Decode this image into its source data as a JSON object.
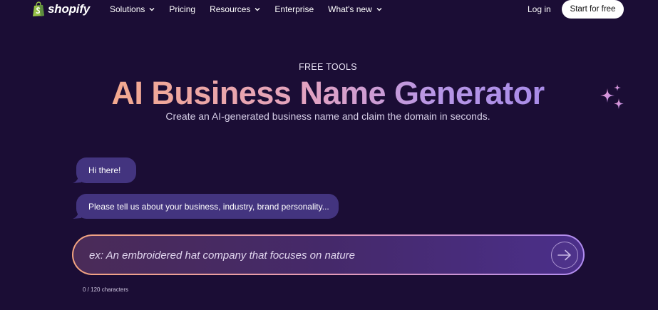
{
  "nav": {
    "logo_text": "shopify",
    "items": [
      {
        "label": "Solutions",
        "has_dropdown": true
      },
      {
        "label": "Pricing",
        "has_dropdown": false
      },
      {
        "label": "Resources",
        "has_dropdown": true
      },
      {
        "label": "Enterprise",
        "has_dropdown": false
      },
      {
        "label": "What's new",
        "has_dropdown": true
      }
    ],
    "login_label": "Log in",
    "cta_label": "Start for free"
  },
  "hero": {
    "eyebrow": "FREE TOOLS",
    "title": "AI Business Name Generator",
    "subtitle": "Create an AI-generated business name and claim the domain in seconds."
  },
  "chat": {
    "messages": [
      "Hi there!",
      "Please tell us about your business, industry, brand personality..."
    ]
  },
  "prompt": {
    "placeholder": "ex: An embroidered hat company that focuses on nature",
    "value": "",
    "counter": "0 / 120 characters"
  },
  "icons": {
    "logo": "shopify-bag-icon",
    "dropdown": "chevron-down-icon",
    "submit": "arrow-right-icon",
    "decoration": "sparkle-icon"
  },
  "colors": {
    "background": "#1b0d35",
    "bubble": "#43347f",
    "cta_bg": "#ffffff",
    "title_gradient_start": "#f4a98e",
    "title_gradient_end": "#a98ce8",
    "input_border_start": "#f2a37f",
    "input_border_end": "#b08cf0",
    "logo_green": "#95bf47"
  }
}
